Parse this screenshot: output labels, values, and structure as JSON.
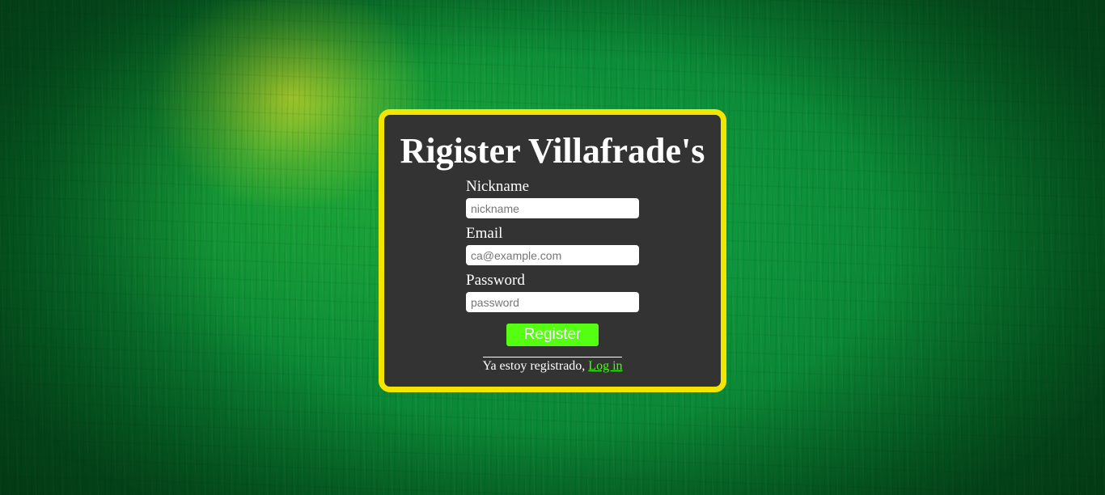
{
  "colors": {
    "card_background": "#333333",
    "card_border": "#f2e600",
    "page_background": "#0b8a36",
    "button_background": "#55ff11",
    "link_color": "#44ff11"
  },
  "register_form": {
    "title": "Rigister Villafrade's",
    "fields": {
      "nickname": {
        "label": "Nickname",
        "placeholder": "nickname",
        "value": ""
      },
      "email": {
        "label": "Email",
        "placeholder": "ca@example.com",
        "value": ""
      },
      "password": {
        "label": "Password",
        "placeholder": "password",
        "value": ""
      }
    },
    "submit_label": "Register",
    "login_prompt": "Ya estoy registrado, ",
    "login_link_label": "Log in"
  }
}
